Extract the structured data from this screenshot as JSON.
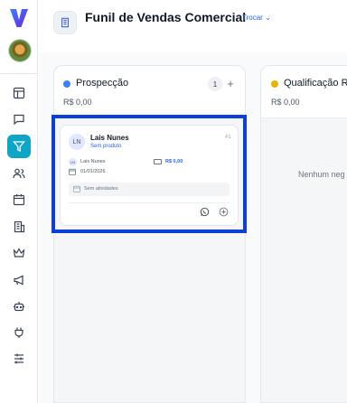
{
  "app": {
    "logo_icon": "v-logo-icon",
    "avatar_icon": "user-avatar-icon"
  },
  "sidebar": {
    "items": [
      {
        "icon": "layout-icon",
        "active": false
      },
      {
        "icon": "chat-icon",
        "active": false
      },
      {
        "icon": "filter-icon",
        "active": true
      },
      {
        "icon": "users-icon",
        "active": false
      },
      {
        "icon": "calendar-icon",
        "active": false
      },
      {
        "icon": "building-icon",
        "active": false
      },
      {
        "icon": "crown-icon",
        "active": false
      },
      {
        "icon": "megaphone-icon",
        "active": false
      },
      {
        "icon": "bot-icon",
        "active": false
      },
      {
        "icon": "plug-icon",
        "active": false
      },
      {
        "icon": "sliders-icon",
        "active": false
      }
    ],
    "active_color": "#0ea5c6"
  },
  "header": {
    "title": "Funil de Vendas Comercial",
    "switch_label": "Trocar",
    "icon": "building-icon"
  },
  "columns": [
    {
      "title": "Prospecção",
      "value": "R$ 0,00",
      "count": "1",
      "color": "#3b82f6",
      "add_label": "+",
      "deals": [
        {
          "initials": "LN",
          "name": "Lais Nunes",
          "product": "Sem produto",
          "id": "#1",
          "owner_initials": "LN",
          "owner": "Lais Nunes",
          "value": "R$ 0,00",
          "date": "01/01/2026",
          "activity": "Sem atividades"
        }
      ]
    },
    {
      "title": "Qualificação Re",
      "value": "R$ 0,00",
      "color": "#eab308",
      "empty_text": "Nenhum neg"
    }
  ],
  "highlight_color": "#0a3fd8"
}
